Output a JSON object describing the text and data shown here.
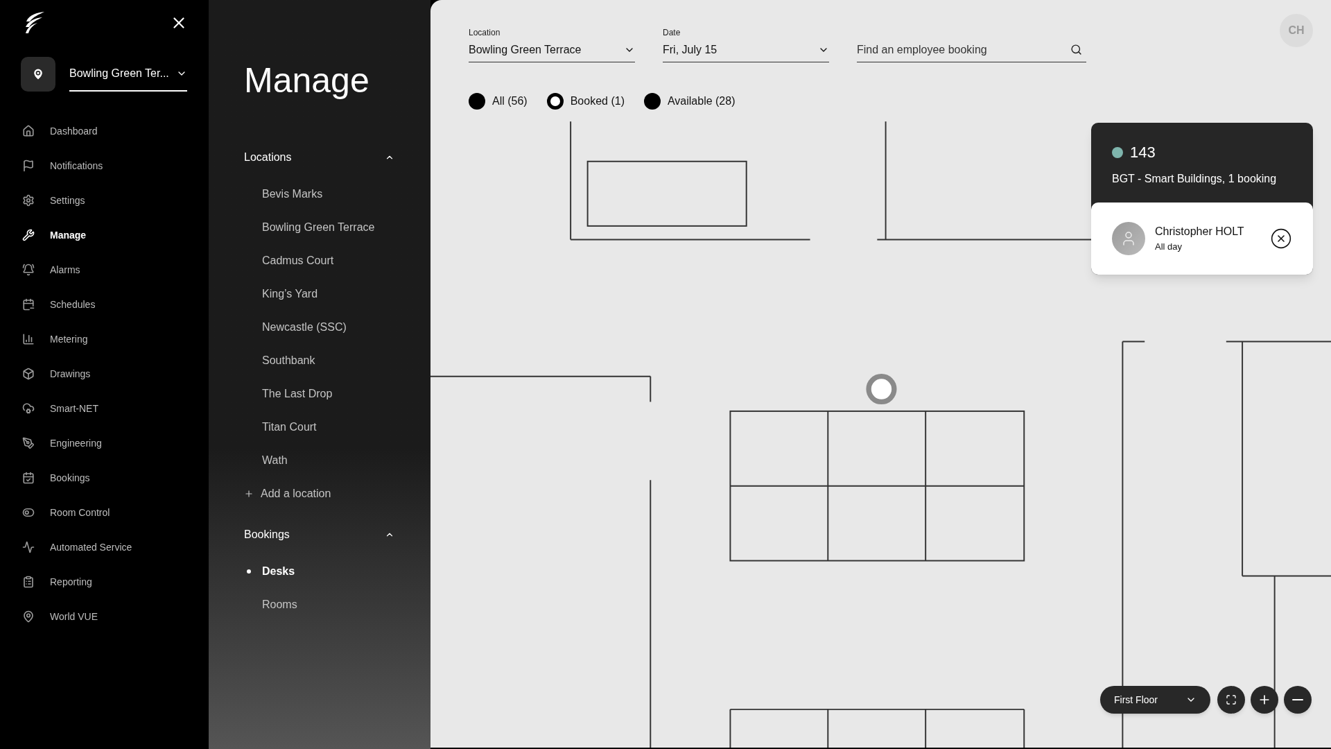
{
  "sidebar": {
    "location": {
      "label": "Bowling Green Ter..."
    },
    "items": [
      {
        "label": "Dashboard",
        "selected": false
      },
      {
        "label": "Notifications",
        "selected": false
      },
      {
        "label": "Settings",
        "selected": false
      },
      {
        "label": "Manage",
        "selected": true
      },
      {
        "label": "Alarms",
        "selected": false
      },
      {
        "label": "Schedules",
        "selected": false
      },
      {
        "label": "Metering",
        "selected": false
      },
      {
        "label": "Drawings",
        "selected": false
      },
      {
        "label": "Smart-NET",
        "selected": false
      },
      {
        "label": "Engineering",
        "selected": false
      },
      {
        "label": "Bookings",
        "selected": false
      },
      {
        "label": "Room Control",
        "selected": false
      },
      {
        "label": "Automated Service",
        "selected": false
      },
      {
        "label": "Reporting",
        "selected": false
      },
      {
        "label": "World VUE",
        "selected": false
      }
    ]
  },
  "manage": {
    "title": "Manage",
    "sections": [
      {
        "label": "Locations",
        "expanded": true,
        "items": [
          {
            "label": "Bevis Marks",
            "selected": false
          },
          {
            "label": "Bowling Green Terrace",
            "selected": false
          },
          {
            "label": "Cadmus Court",
            "selected": false
          },
          {
            "label": "King’s Yard",
            "selected": false
          },
          {
            "label": "Newcastle (SSC)",
            "selected": false
          },
          {
            "label": "Southbank",
            "selected": false
          },
          {
            "label": "The Last Drop",
            "selected": false
          },
          {
            "label": "Titan Court",
            "selected": false
          },
          {
            "label": "Wath",
            "selected": false
          }
        ],
        "add_label": "Add a location"
      },
      {
        "label": "Bookings",
        "expanded": true,
        "items": [
          {
            "label": "Desks",
            "selected": true
          },
          {
            "label": "Rooms",
            "selected": false
          }
        ]
      }
    ]
  },
  "filters": {
    "location": {
      "label": "Location",
      "value": "Bowling Green Terrace"
    },
    "date": {
      "label": "Date",
      "value": "Fri, July 15"
    },
    "search": {
      "placeholder": "Find an employee booking"
    }
  },
  "legend": [
    {
      "label": "All (56)",
      "selected": false
    },
    {
      "label": "Booked (1)",
      "selected": true
    },
    {
      "label": "Available (28)",
      "selected": false
    }
  ],
  "user": {
    "initials": "CH"
  },
  "popup": {
    "desk": "143",
    "color": "#7fb5ad",
    "subtitle": "BGT - Smart Buildings, 1 booking",
    "booking": {
      "name": "Christopher HOLT",
      "time": "All day"
    }
  },
  "floor": {
    "value": "First Floor"
  }
}
